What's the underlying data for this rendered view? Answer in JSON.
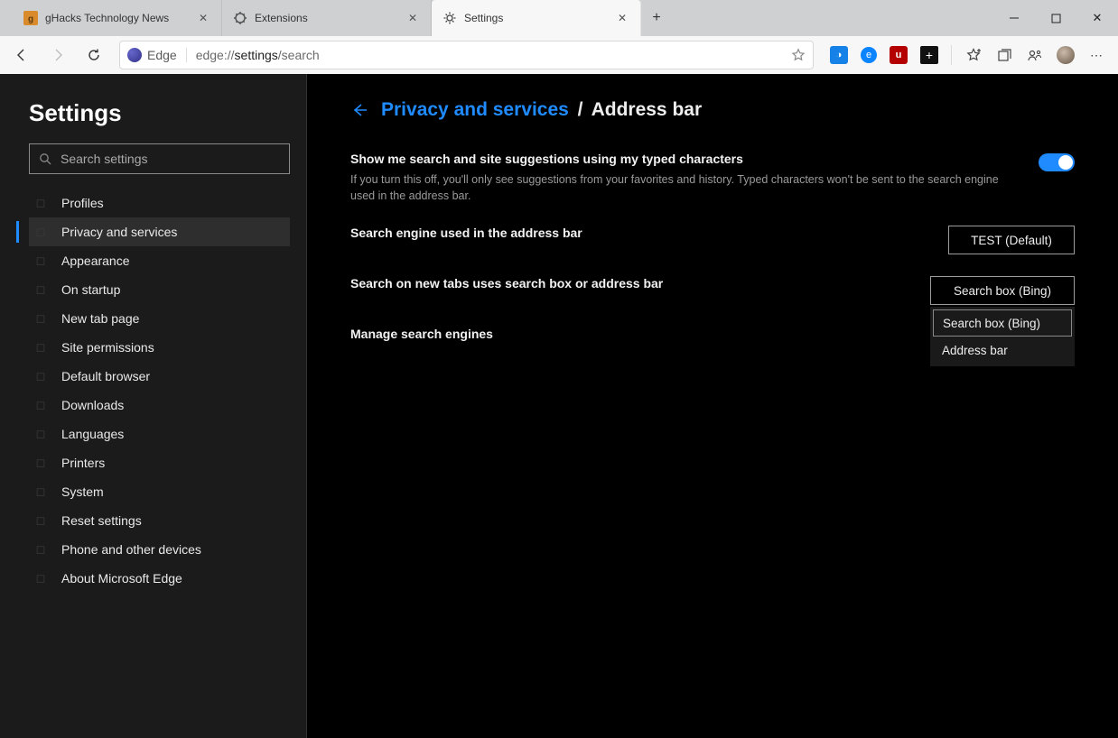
{
  "tabs": [
    {
      "label": "gHacks Technology News"
    },
    {
      "label": "Extensions"
    },
    {
      "label": "Settings"
    }
  ],
  "addressbar": {
    "chip": "Edge",
    "url_prefix": "edge://",
    "url_strong": "settings",
    "url_suffix": "/search"
  },
  "sidebar": {
    "title": "Settings",
    "search_placeholder": "Search settings",
    "items": [
      {
        "label": "Profiles"
      },
      {
        "label": "Privacy and services"
      },
      {
        "label": "Appearance"
      },
      {
        "label": "On startup"
      },
      {
        "label": "New tab page"
      },
      {
        "label": "Site permissions"
      },
      {
        "label": "Default browser"
      },
      {
        "label": "Downloads"
      },
      {
        "label": "Languages"
      },
      {
        "label": "Printers"
      },
      {
        "label": "System"
      },
      {
        "label": "Reset settings"
      },
      {
        "label": "Phone and other devices"
      },
      {
        "label": "About Microsoft Edge"
      }
    ]
  },
  "crumb": {
    "parent": "Privacy and services",
    "current": "Address bar"
  },
  "settings": {
    "suggestions": {
      "title": "Show me search and site suggestions using my typed characters",
      "desc": "If you turn this off, you'll only see suggestions from your favorites and history. Typed characters won't be sent to the search engine used in the address bar.",
      "enabled": true
    },
    "search_engine": {
      "title": "Search engine used in the address bar",
      "value": "TEST (Default)"
    },
    "new_tabs": {
      "title": "Search on new tabs uses search box or address bar",
      "value": "Search box (Bing)",
      "options": [
        "Search box (Bing)",
        "Address bar"
      ]
    },
    "manage": {
      "title": "Manage search engines"
    }
  }
}
